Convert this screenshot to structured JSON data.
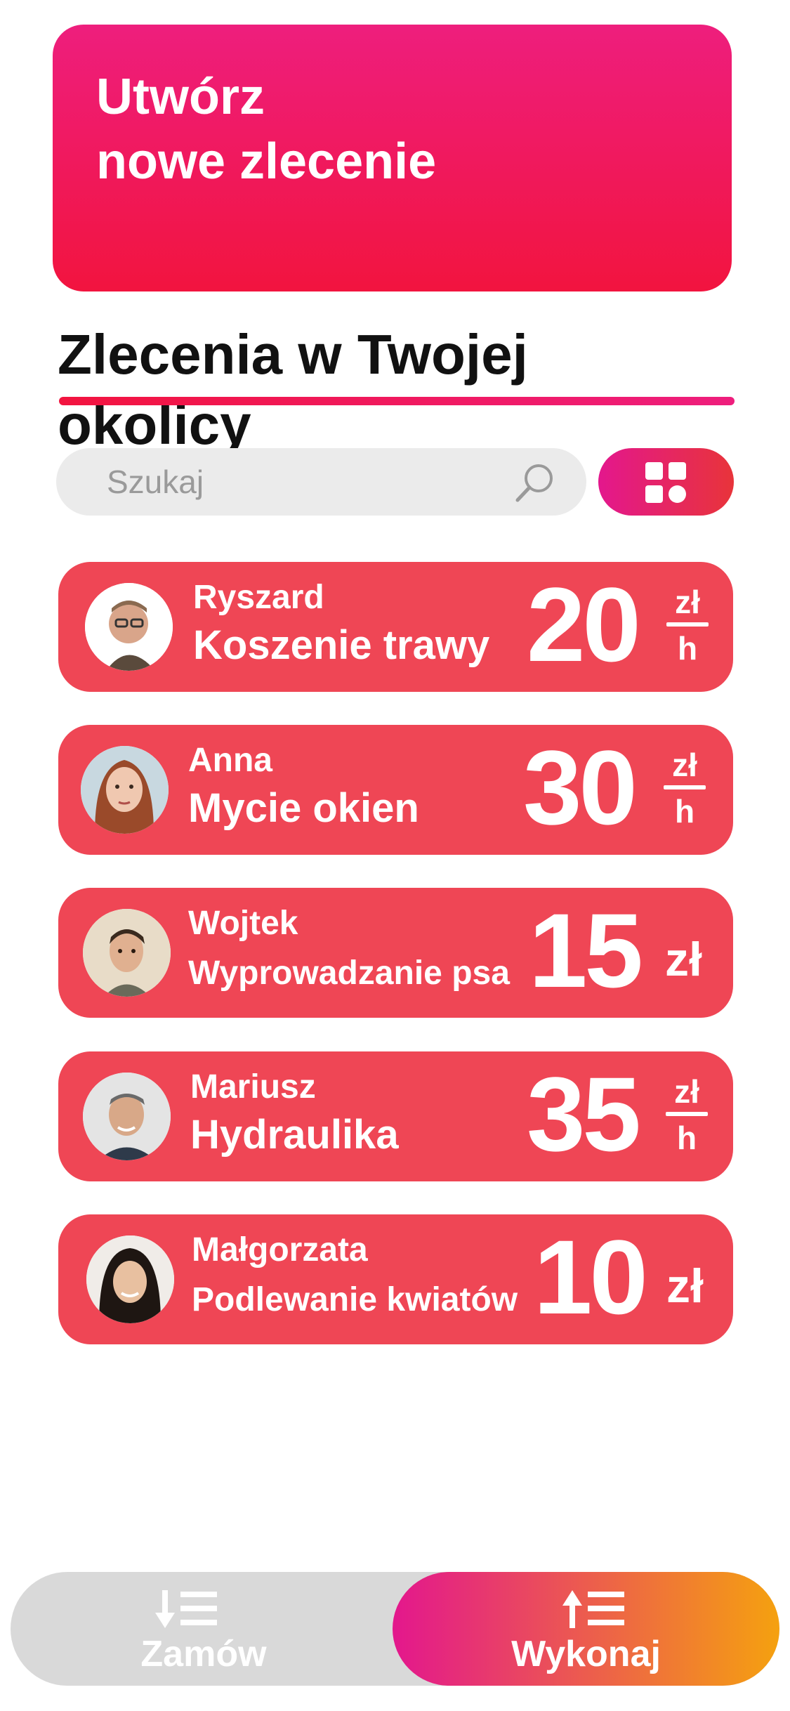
{
  "create_card": {
    "line1": "Utwórz",
    "line2": "nowe zlecenie"
  },
  "section": {
    "title": "Zlecenia w Twojej okolicy"
  },
  "search": {
    "placeholder": "Szukaj"
  },
  "icons": {
    "search": "magnifier-icon",
    "view_toggle": "grid-icon",
    "order_tab": "arrow-down-list-icon",
    "do_tab": "arrow-up-list-icon"
  },
  "colors": {
    "primary_pink": "#ee1e7d",
    "primary_red": "#f2143f",
    "card_red": "#ef4655",
    "tab_gray": "#d9d9d9",
    "accent_orange": "#f5a10f"
  },
  "tasks": [
    {
      "name": "Ryszard",
      "title": "Koszenie trawy",
      "price": "20",
      "unit_num": "zł",
      "unit_den": "h"
    },
    {
      "name": "Anna",
      "title": "Mycie okien",
      "price": "30",
      "unit_num": "zł",
      "unit_den": "h"
    },
    {
      "name": "Wojtek",
      "title": "Wyprowadzanie psa",
      "price": "15",
      "unit": "zł"
    },
    {
      "name": "Mariusz",
      "title": "Hydraulika",
      "price": "35",
      "unit_num": "zł",
      "unit_den": "h"
    },
    {
      "name": "Małgorzata",
      "title": "Podlewanie kwiatów",
      "price": "10",
      "unit": "zł"
    }
  ],
  "tabs": {
    "order": "Zamów",
    "do": "Wykonaj"
  }
}
